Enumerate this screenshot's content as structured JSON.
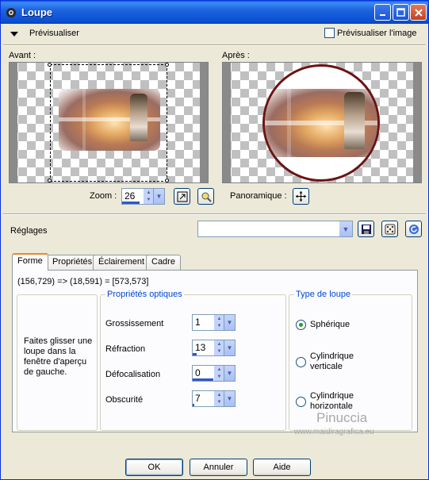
{
  "window": {
    "title": "Loupe"
  },
  "preview_section": {
    "label": "Prévisualiser",
    "checkbox_label": "Prévisualiser l'image",
    "checked": false
  },
  "before": {
    "label": "Avant :"
  },
  "after": {
    "label": "Après :"
  },
  "zoom": {
    "label": "Zoom :",
    "value": "26"
  },
  "panoramic": {
    "label": "Panoramique :"
  },
  "settings": {
    "label": "Réglages",
    "value": ""
  },
  "tabs": [
    {
      "label": "Forme",
      "active": true
    },
    {
      "label": "Propriétés",
      "active": false
    },
    {
      "label": "Éclairement",
      "active": false
    },
    {
      "label": "Cadre",
      "active": false
    }
  ],
  "coords": "(156,729) => (18,591) = [573,573]",
  "hint": "Faites glisser une loupe dans la fenêtre d'aperçu de gauche.",
  "optical": {
    "title": "Propriétés optiques",
    "fields": [
      {
        "label": "Grossissement",
        "value": "1"
      },
      {
        "label": "Réfraction",
        "value": "13"
      },
      {
        "label": "Défocalisation",
        "value": "0"
      },
      {
        "label": "Obscurité",
        "value": "7"
      }
    ]
  },
  "lens_type": {
    "title": "Type de loupe",
    "options": [
      {
        "label": "Sphérique",
        "selected": true
      },
      {
        "label": "Cylindrique verticale",
        "selected": false
      },
      {
        "label": "Cylindrique horizontale",
        "selected": false
      }
    ]
  },
  "watermark": {
    "name": "Pinuccia",
    "url": "www.maidiragrafica.eu"
  },
  "buttons": {
    "ok": "OK",
    "cancel": "Annuler",
    "help": "Aide"
  },
  "colors": {
    "title_bar": "#0a5ddb",
    "tab_accent": "#e68b2c",
    "group_title": "#0046d5",
    "lens_ring": "#6b1414"
  },
  "icons": [
    "app-icon",
    "minimize-icon",
    "maximize-icon",
    "close-icon",
    "collapse-arrow-icon",
    "fit-zoom-icon",
    "proof-icon",
    "pan-move-icon",
    "save-preset-icon",
    "random-dice-icon",
    "reset-icon"
  ]
}
